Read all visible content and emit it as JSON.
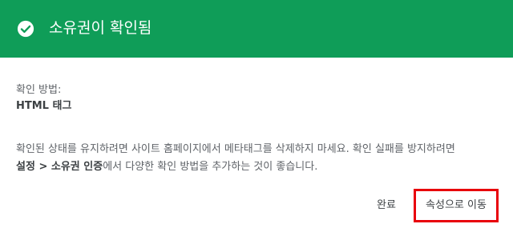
{
  "dialog": {
    "title": "소유권이 확인됨",
    "header_color": "#0f9d58",
    "icon": "check-circle-icon"
  },
  "method": {
    "label": "확인 방법:",
    "value": "HTML 태그"
  },
  "message": {
    "line1": "확인된 상태를 유지하려면 사이트 홈페이지에서 메타태그를 삭제하지 마세요. 확인 실패를 방지하려면",
    "bold_link": "설정 > 소유권 인증",
    "line2_rest": "에서 다양한 확인 방법을 추가하는 것이 좋습니다."
  },
  "actions": {
    "done_label": "완료",
    "go_label": "속성으로 이동",
    "highlight_color": "#e8000b"
  }
}
